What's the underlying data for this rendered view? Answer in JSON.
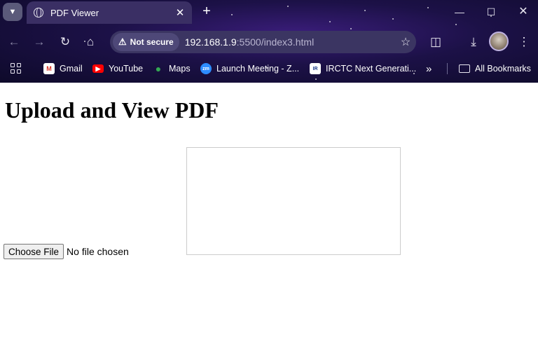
{
  "browser": {
    "tab_title": "PDF Viewer",
    "security_label": "Not secure",
    "url_host": "192.168.1.9",
    "url_path": ":5500/index3.html",
    "bookmarks": [
      {
        "label": "Gmail",
        "icon": "gmail-icon"
      },
      {
        "label": "YouTube",
        "icon": "youtube-icon"
      },
      {
        "label": "Maps",
        "icon": "maps-icon"
      },
      {
        "label": "Launch Meeting - Z...",
        "icon": "zoom-icon"
      },
      {
        "label": "IRCTC Next Generati...",
        "icon": "irctc-icon"
      }
    ],
    "overflow_label": "»",
    "all_bookmarks_label": "All Bookmarks"
  },
  "page": {
    "heading": "Upload and View PDF",
    "choose_file_label": "Choose File",
    "file_status": "No file chosen"
  },
  "colors": {
    "chrome_bg": "#1c1147",
    "tab_active": "#3a2f64",
    "omnibox": "#3b3562"
  }
}
